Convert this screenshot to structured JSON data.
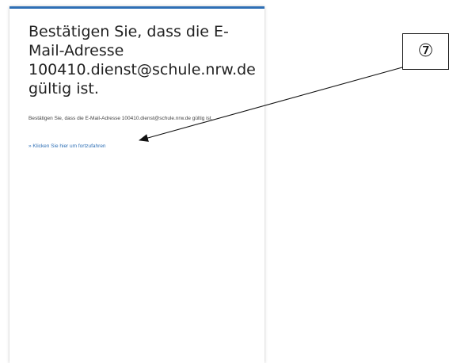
{
  "page": {
    "heading": "Bestätigen Sie, dass die E-Mail-Adresse 100410.dienst@schule.nrw.de gültig ist.",
    "body_text": "Bestätigen Sie, dass die E-Mail-Adresse 100410.dienst@schule.nrw.de gültig ist.",
    "link_text": "» Klicken Sie hier um fortzufahren"
  },
  "annotation": {
    "callout_number": "⑦"
  },
  "colors": {
    "accent": "#2e6fb5",
    "text": "#222222",
    "annotation": "#111111"
  }
}
